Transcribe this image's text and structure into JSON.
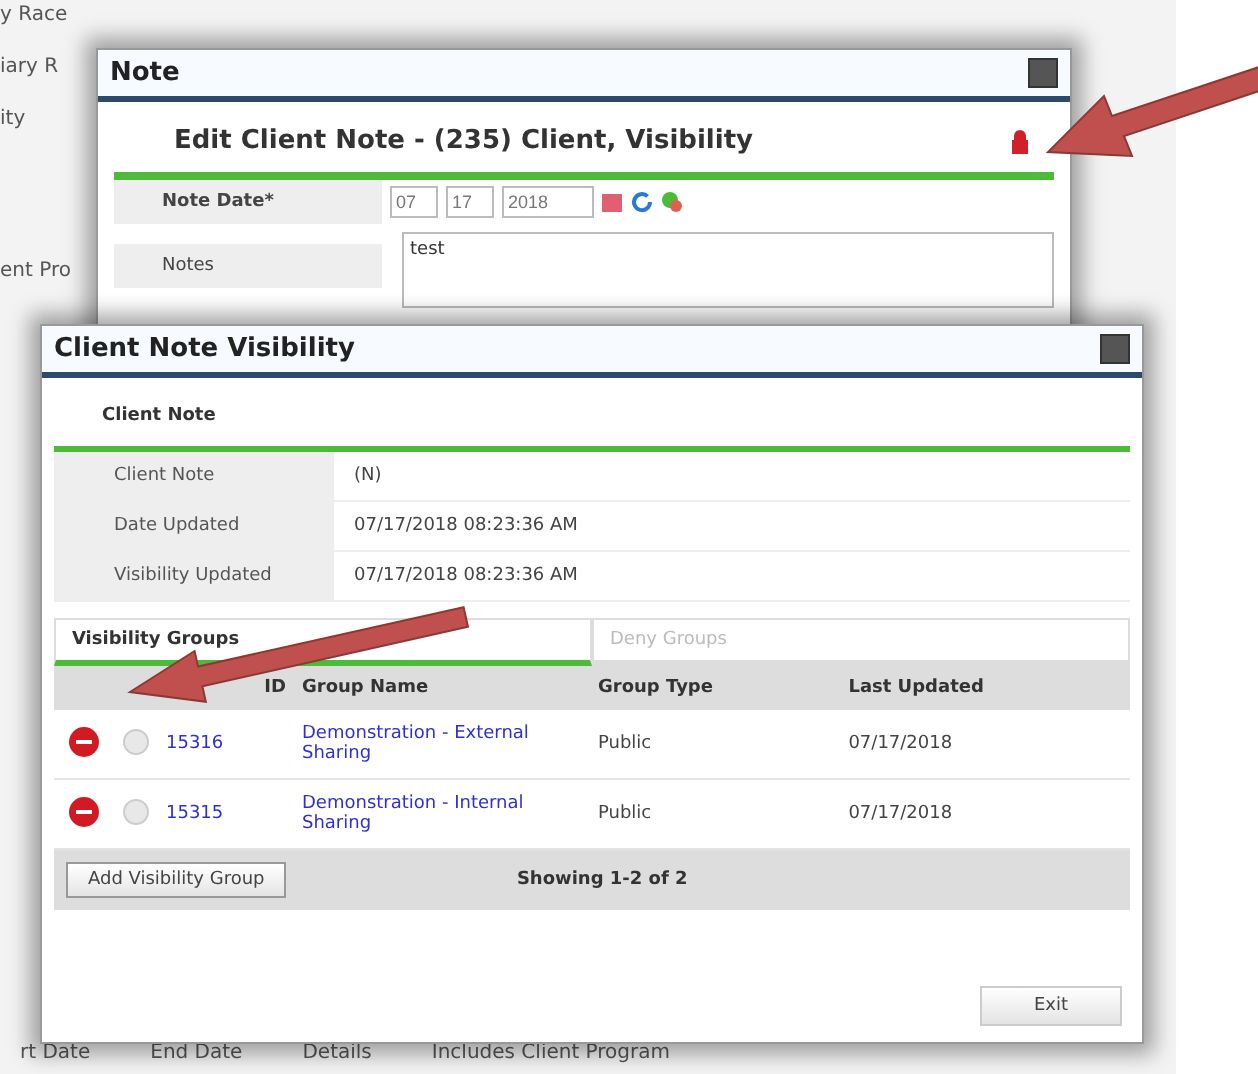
{
  "background": {
    "labels": [
      "y Race",
      "iary R",
      "ity",
      "ent Pro"
    ],
    "footer_columns": [
      "rt Date",
      "End Date",
      "Details",
      "Includes Client Program"
    ]
  },
  "note_window": {
    "title": "Note",
    "heading": "Edit Client Note - (235) Client, Visibility",
    "fields": [
      {
        "label": "Note Date*",
        "kind": "date",
        "parts": [
          "07",
          "17",
          "2018"
        ]
      },
      {
        "label": "Notes",
        "kind": "text",
        "value": "test"
      }
    ]
  },
  "visibility_window": {
    "title": "Client Note Visibility",
    "section": "Client Note",
    "info": [
      {
        "label": "Client Note",
        "value": "(N)"
      },
      {
        "label": "Date Updated",
        "value": "07/17/2018 08:23:36 AM"
      },
      {
        "label": "Visibility Updated",
        "value": "07/17/2018 08:23:36 AM"
      }
    ],
    "tabs": [
      {
        "label": "Visibility Groups",
        "selected": true
      },
      {
        "label": "Deny Groups",
        "selected": false
      }
    ],
    "table": {
      "columns": [
        "ID",
        "Group Name",
        "Group Type",
        "Last Updated"
      ],
      "rows": [
        {
          "id": "15316",
          "name": "Demonstration - External Sharing",
          "type": "Public",
          "updated": "07/17/2018"
        },
        {
          "id": "15315",
          "name": "Demonstration - Internal Sharing",
          "type": "Public",
          "updated": "07/17/2018"
        }
      ]
    },
    "add_button": "Add Visibility Group",
    "paging": "Showing 1-2 of 2",
    "exit_button": "Exit"
  }
}
